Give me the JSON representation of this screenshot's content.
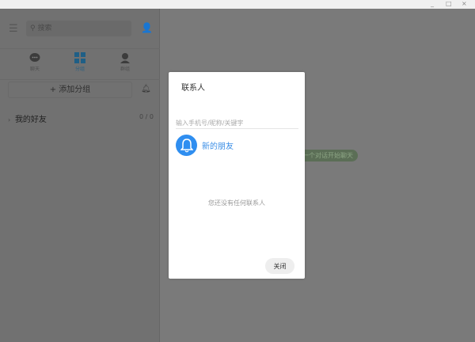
{
  "window": {
    "minimize": "_",
    "maximize": "□",
    "close": "×"
  },
  "sidebar": {
    "search_placeholder": "搜索",
    "tabs": [
      {
        "label": "聊天"
      },
      {
        "label": "分组"
      },
      {
        "label": "群组"
      }
    ],
    "add_group": "+ 添加分组",
    "groups": [
      {
        "name": "我的好友",
        "count": "0 / 0"
      }
    ]
  },
  "main": {
    "hint": "一个对话开始聊天"
  },
  "dialog": {
    "title": "联系人",
    "search_placeholder": "输入手机号/昵称/关键字",
    "new_friend": "新的朋友",
    "empty": "您还没有任何联系人",
    "close": "关闭"
  },
  "colors": {
    "accent": "#2f8ef0"
  }
}
